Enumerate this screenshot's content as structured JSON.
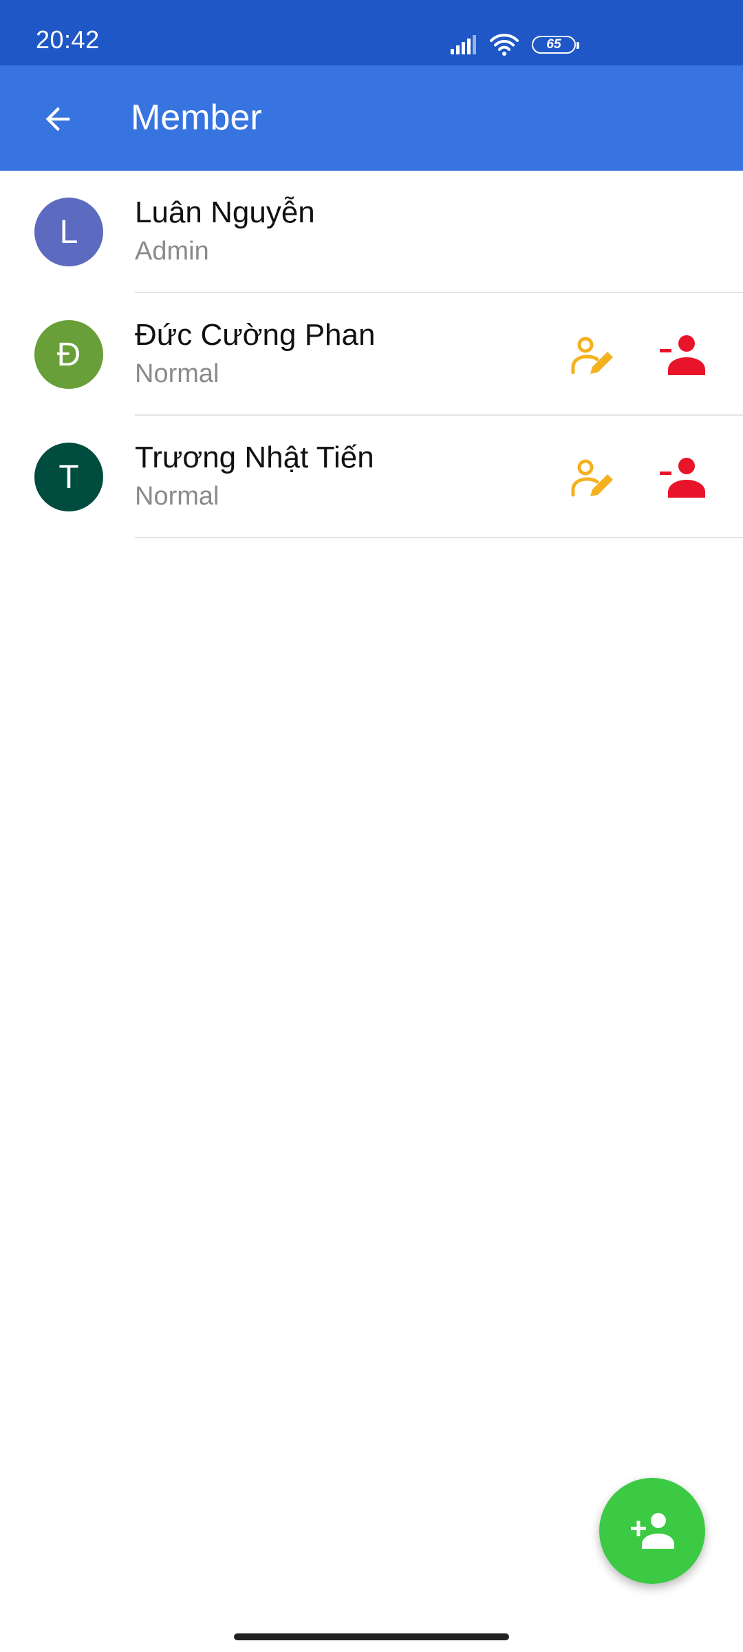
{
  "status_bar": {
    "time": "20:42",
    "battery_level": "65",
    "icons": [
      "signal-icon",
      "wifi-icon",
      "battery-icon"
    ]
  },
  "app_bar": {
    "title": "Member",
    "back_icon": "arrow-back-icon"
  },
  "members": [
    {
      "initial": "L",
      "name": "Luân Nguyễn",
      "role": "Admin",
      "avatar_color": "#5c6bc0",
      "show_actions": false
    },
    {
      "initial": "Đ",
      "name": "Đức Cường Phan",
      "role": "Normal",
      "avatar_color": "#689f38",
      "show_actions": true
    },
    {
      "initial": "T",
      "name": "Trương Nhật Tiến",
      "role": "Normal",
      "avatar_color": "#004d40",
      "show_actions": true
    }
  ],
  "actions": {
    "edit_icon": "edit-member-icon",
    "remove_icon": "remove-member-icon"
  },
  "fab": {
    "icon": "add-person-icon"
  },
  "colors": {
    "status_bar": "#1f58c6",
    "app_bar": "#3874e0",
    "edit_action": "#f4b120",
    "remove_action": "#e8142a",
    "fab": "#3cc944"
  }
}
